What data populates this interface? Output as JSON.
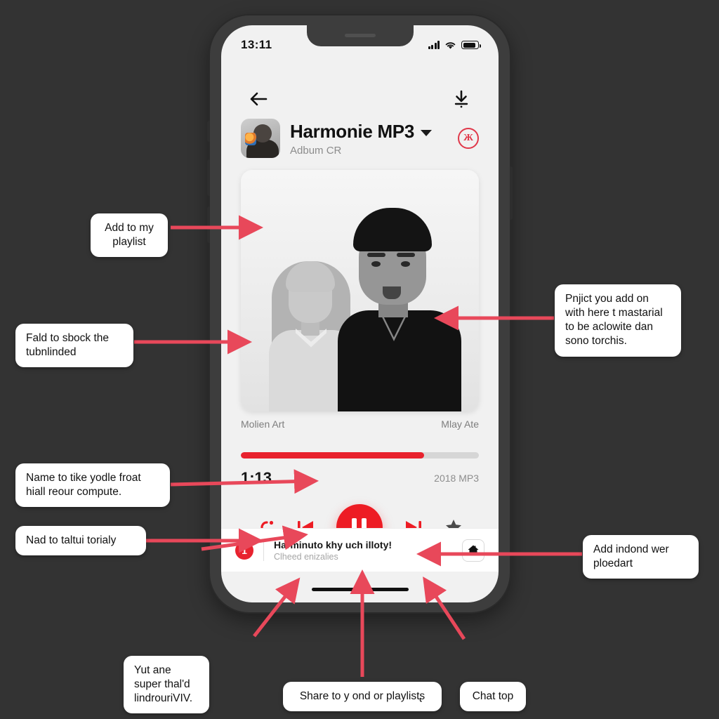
{
  "background_color": "#333333",
  "accent_color": "#ed1c24",
  "phone": {
    "status_bar": {
      "time": "13:11",
      "icons": [
        "signal-bars-icon",
        "wifi-icon",
        "battery-icon"
      ]
    },
    "nav": {
      "back_icon": "arrow-left-icon",
      "download_icon": "download-icon"
    },
    "header": {
      "title": "Harmonie MP3",
      "subtitle": "Adbum CR",
      "dropdown_icon": "chevron-down-icon",
      "badge_glyph": "Ж",
      "badge_color": "#e0384a",
      "avatar_name": "artist-avatar"
    },
    "album_art_alt": "album-artwork",
    "meta": {
      "left": "Molien Art",
      "right": "Mlay Ate"
    },
    "progress": {
      "percent": 77,
      "fill_color": "#e8222e",
      "track_color": "#d6d6d6"
    },
    "time": {
      "current": "1:13",
      "format": "2018 MP3"
    },
    "controls": {
      "shuffle_icon": "shuffle-icon",
      "previous_icon": "skip-previous-icon",
      "play_pause_icon": "pause-icon",
      "next_icon": "skip-next-icon",
      "favorite_icon": "star-icon"
    },
    "bottom_bar": {
      "count": "1",
      "title": "Harminuto khy uch illoty!",
      "subtitle": "Clheed enizalies",
      "home_icon": "home-icon"
    }
  },
  "callouts": [
    {
      "id": "add-to-my-playlist",
      "text": "Add to my\nplaylist"
    },
    {
      "id": "fald-to-sbock",
      "text": "Fald to sbock the\ntubnlinded"
    },
    {
      "id": "name-to-tike",
      "text": "Name to tike yodle froat\nhiall reour compute."
    },
    {
      "id": "nad-to-talt",
      "text": "Nad to taltui torialy"
    },
    {
      "id": "pnjict-you-add",
      "text": "Pnjict you add on\nwith here t mastarial\nto be aclowite dan\nsono torchis."
    },
    {
      "id": "add-indond-wer",
      "text": "Add indond wer\nploedart"
    },
    {
      "id": "yut-ane-super",
      "text": "Yut ane\nsuper thal'd\nlindrouriVIV."
    },
    {
      "id": "share-to-playlist",
      "text": "Share to y ond or playlistʂ"
    },
    {
      "id": "chat-top",
      "text": "Chat top"
    }
  ]
}
